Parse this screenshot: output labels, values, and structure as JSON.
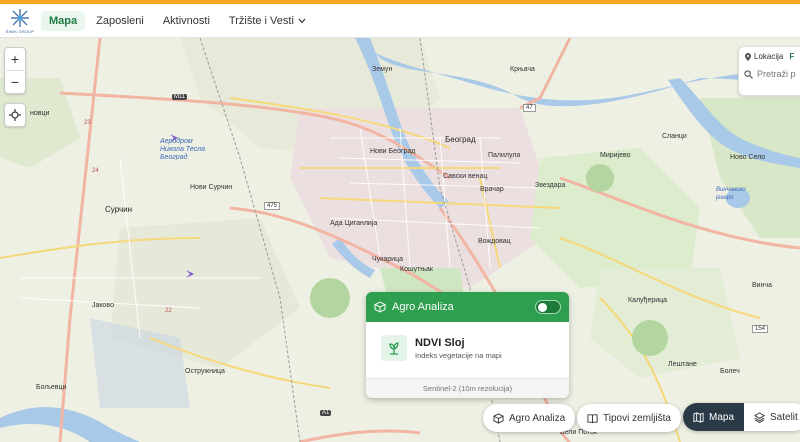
{
  "nav": {
    "logo_text": "ŠINIK GROUP",
    "items": [
      {
        "label": "Mapa",
        "active": true
      },
      {
        "label": "Zaposleni",
        "active": false
      },
      {
        "label": "Aktivnosti",
        "active": false
      },
      {
        "label": "Tržište i Vesti",
        "active": false,
        "dropdown": true
      }
    ]
  },
  "map_controls": {
    "zoom_in": "+",
    "zoom_out": "−"
  },
  "search_panel": {
    "tab_location": "Lokacija",
    "tab_other": "F",
    "placeholder": "Pretraži p"
  },
  "map_labels": {
    "cities": [
      "Земун",
      "Београд",
      "Нови Београд",
      "Палилула",
      "Савски венац",
      "Врачар",
      "Звездара",
      "Вождовац",
      "Чукарица",
      "Сурчин",
      "Нови Сурчин",
      "Јаково",
      "Остружница",
      "Бољевци",
      "Крњача",
      "Сланци",
      "Миријево",
      "Калуђерица",
      "Лештане",
      "Болеч",
      "Винча",
      "Ада Циганлија",
      "Кошутњак",
      "Аеродром Никола Тесла Београд",
      "Бели Поток",
      "Ново Село",
      "Винчанско језеро",
      "новци"
    ],
    "roads": [
      "M11",
      "475",
      "47",
      "A1",
      "154",
      "23",
      "24",
      "22"
    ]
  },
  "agro": {
    "title": "Agro Analiza",
    "toggle_on": false,
    "layer_title": "NDVI Sloj",
    "layer_subtitle": "Indeks vegetacije na mapi",
    "footer": "Sentinel-2 (10m rezolucija)"
  },
  "bottom": {
    "agro_button": "Agro Analiza",
    "soil_button": "Tipovi zemljišta",
    "map_mode": "Mapa",
    "satellite_mode": "Satelit",
    "active_mode": "Mapa"
  },
  "colors": {
    "accent": "#f5a623",
    "brand_green": "#2e9e4f",
    "active_nav": "#1f7a44",
    "mode_active": "#2b3a47"
  }
}
